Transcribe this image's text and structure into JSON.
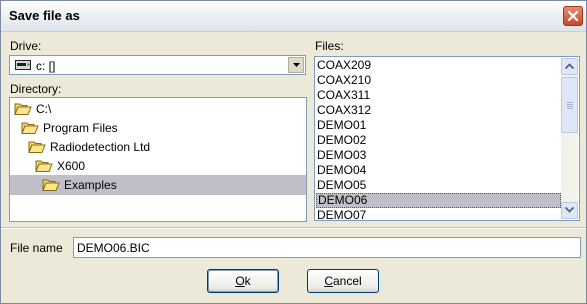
{
  "window": {
    "title": "Save file as"
  },
  "drive": {
    "label": "Drive:",
    "value": "c: []"
  },
  "directory": {
    "label": "Directory:",
    "items": [
      {
        "label": "C:\\",
        "depth": 0,
        "selected": false
      },
      {
        "label": "Program Files",
        "depth": 1,
        "selected": false
      },
      {
        "label": "Radiodetection Ltd",
        "depth": 2,
        "selected": false
      },
      {
        "label": "X600",
        "depth": 3,
        "selected": false
      },
      {
        "label": "Examples",
        "depth": 4,
        "selected": true
      }
    ]
  },
  "files": {
    "label": "Files:",
    "items": [
      "COAX209",
      "COAX210",
      "COAX311",
      "COAX312",
      "DEMO01",
      "DEMO02",
      "DEMO03",
      "DEMO04",
      "DEMO05",
      "DEMO06",
      "DEMO07"
    ],
    "selected": "DEMO06"
  },
  "filename": {
    "label": "File name",
    "value": "DEMO06.BIC"
  },
  "buttons": {
    "ok": {
      "prefix": "",
      "hotkey": "O",
      "rest": "k"
    },
    "cancel": {
      "prefix": "",
      "hotkey": "C",
      "rest": "ancel"
    }
  },
  "icons": [
    "close-icon",
    "drive-icon",
    "dropdown-arrow-icon",
    "folder-icon",
    "scroll-up-icon",
    "scroll-down-icon"
  ]
}
